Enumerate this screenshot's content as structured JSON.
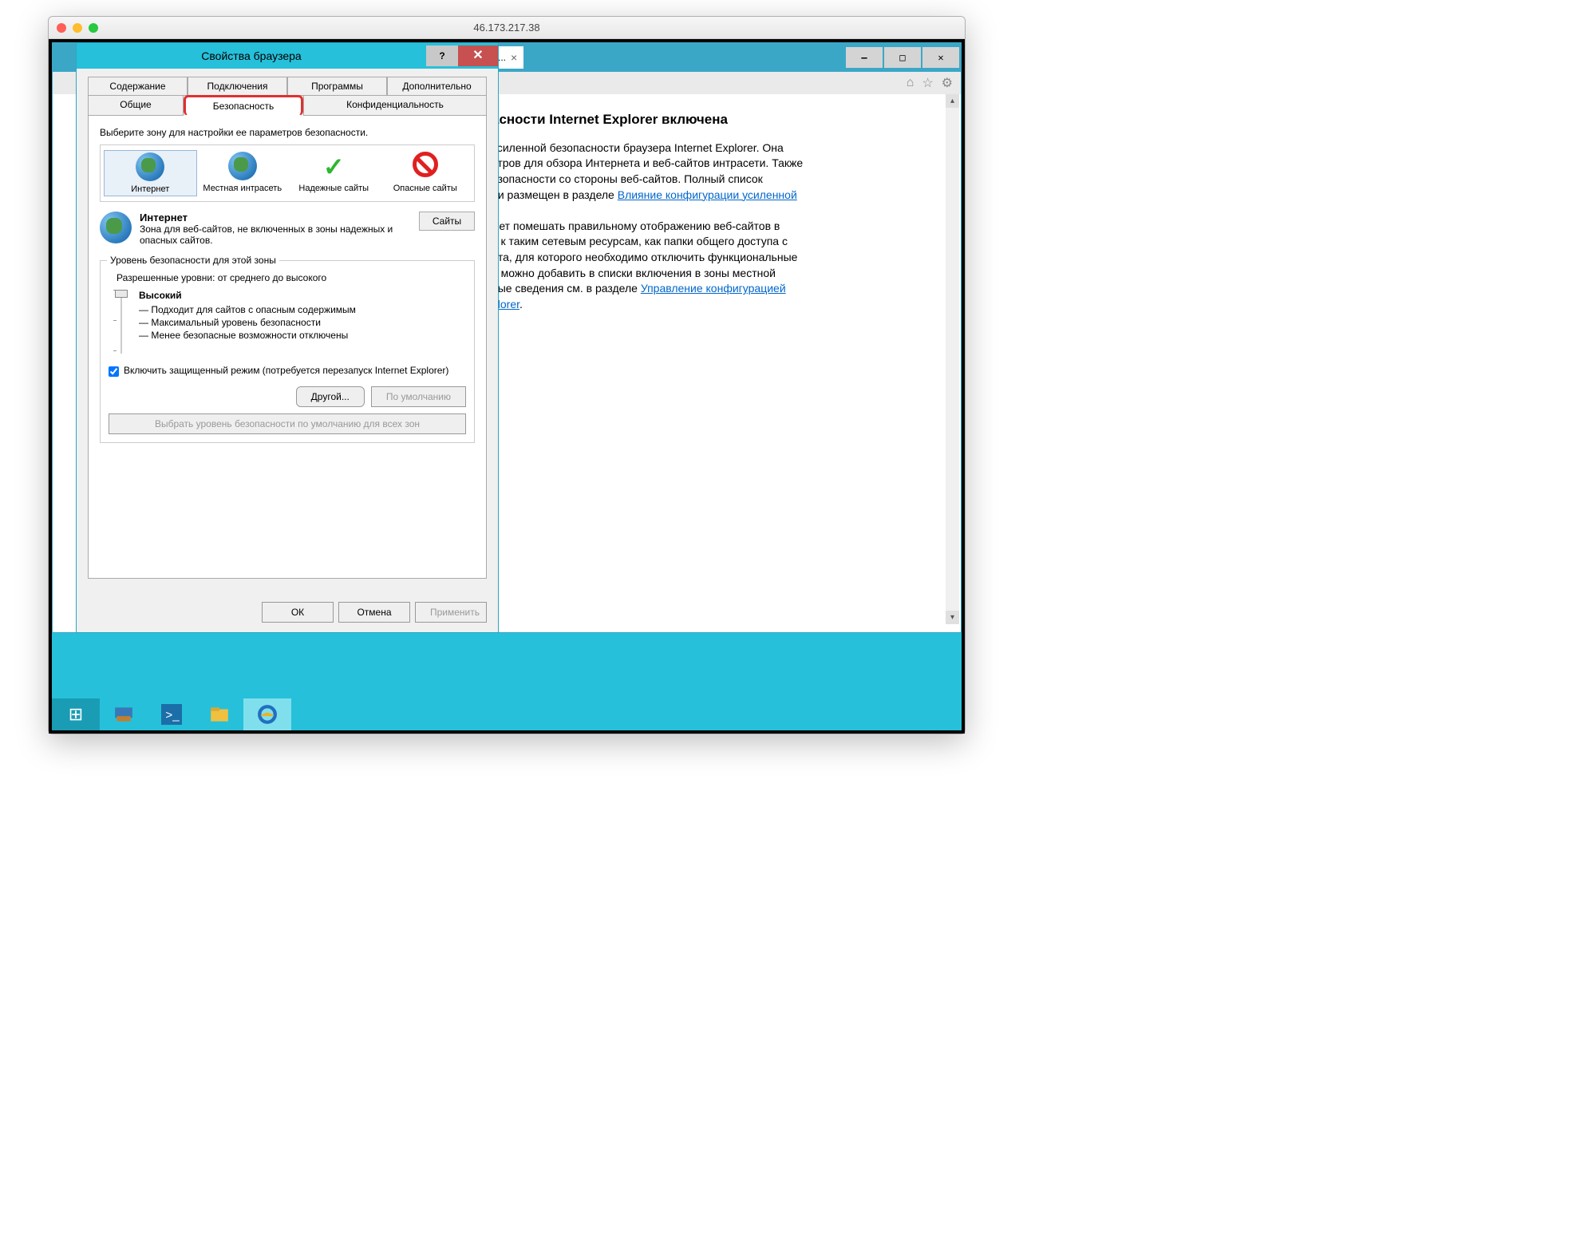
{
  "mac": {
    "title": "46.173.217.38"
  },
  "ie": {
    "tab_label": "ной...",
    "win_buttons": {
      "min": "—",
      "max": "□",
      "close": "✕"
    },
    "toolbar_icons": {
      "home": "⌂",
      "star": "☆",
      "gear": "⚙"
    },
    "heading": "асности Internet Explorer включена",
    "p1a": "усиленной безопасности браузера Internet Explorer. Она",
    "p1b": "етров для обзора Интернета и веб-сайтов интрасети. Также",
    "p1c": "езопасности со стороны веб-сайтов. Полный список",
    "p1d": "ии размещен в разделе ",
    "p1_link": "Влияние конфигурации усиленной",
    "p2a": "жет помешать правильному отображению веб-сайтов в",
    "p2b": "п к таким сетевым ресурсам, как папки общего доступа с",
    "p2c": "йта, для которого необходимо отключить функциональные",
    "p2d": "о можно добавить в списки включения в зоны местной",
    "p2e": "ные сведения см. в разделе ",
    "p2_link": "Управление конфигурацией",
    "p2_link2": "plorer",
    "p2_dot": "."
  },
  "dialog": {
    "title": "Свойства браузера",
    "help": "?",
    "close": "✕",
    "tabs_row1": [
      "Содержание",
      "Подключения",
      "Программы",
      "Дополнительно"
    ],
    "tabs_row2": [
      "Общие",
      "Безопасность",
      "Конфиденциальность"
    ],
    "zone_instruction": "Выберите зону для настройки ее параметров безопасности.",
    "zones": [
      {
        "label": "Интернет"
      },
      {
        "label": "Местная интрасеть"
      },
      {
        "label": "Надежные сайты"
      },
      {
        "label": "Опасные сайты"
      }
    ],
    "selected_zone_title": "Интернет",
    "selected_zone_desc": "Зона для веб-сайтов, не включенных в зоны надежных и опасных сайтов.",
    "sites_btn": "Сайты",
    "group_title": "Уровень безопасности для этой зоны",
    "allowed_levels": "Разрешенные уровни: от среднего до высокого",
    "level_name": "Высокий",
    "level_lines": [
      "— Подходит для сайтов с опасным содержимым",
      "— Максимальный уровень безопасности",
      "— Менее безопасные возможности отключены"
    ],
    "checkbox_label": "Включить защищенный режим (потребуется перезапуск Internet Explorer)",
    "custom_btn": "Другой...",
    "default_btn": "По умолчанию",
    "reset_all_btn": "Выбрать уровень безопасности по умолчанию для всех зон",
    "ok": "ОК",
    "cancel": "Отмена",
    "apply": "Применить"
  },
  "taskbar": {
    "start": "⊞"
  }
}
